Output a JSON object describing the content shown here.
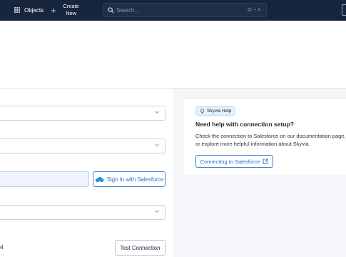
{
  "topbar": {
    "objects_label": "Objects",
    "create_label": "Create New",
    "search_placeholder": "Search...",
    "search_shortcut": "⌘ + K",
    "objects_icon": "grid-icon",
    "create_icon": "plus-icon",
    "search_icon": "search-icon"
  },
  "form": {
    "signin_label": "Sign In with Salesforce",
    "signin_icon": "salesforce-cloud-icon",
    "cancel_label": "cel",
    "test_connection_label": "Test Connection",
    "select_icon": "chevron-down-icon"
  },
  "help": {
    "badge": "Skyvia Help",
    "badge_icon": "lightbulb-icon",
    "title": "Need help with connection setup?",
    "text_line1": "Check the connection to Salesforce on our documentation page,",
    "text_line2": "or explore more helpful information about Skyvia.",
    "link_label": "Connecting to Salesforce",
    "link_icon": "external-link-icon"
  },
  "colors": {
    "topbar_bg": "#16253b",
    "accent": "#2d6fc4",
    "badge_bg": "#e4f0fb"
  }
}
